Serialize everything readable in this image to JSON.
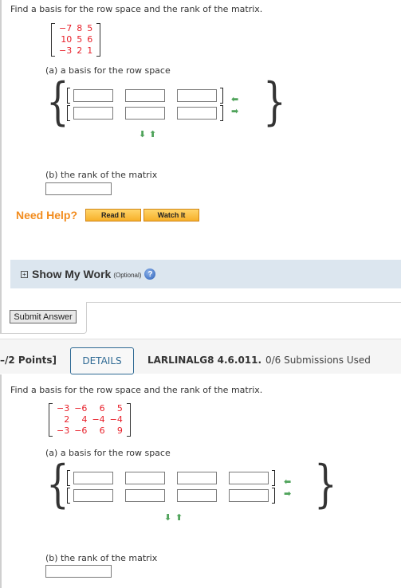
{
  "problem1": {
    "prompt": "Find a basis for the row space and the rank of the matrix.",
    "matrix": [
      [
        "−7",
        "8",
        "5"
      ],
      [
        "10",
        "5",
        "6"
      ],
      [
        "−3",
        "2",
        "1"
      ]
    ],
    "part_a_label": "(a) a basis for the row space",
    "answer_rows": [
      [
        "",
        "",
        ""
      ],
      [
        "",
        "",
        ""
      ]
    ],
    "part_b_label": "(b) the rank of the matrix",
    "rank_value": ""
  },
  "help": {
    "need_help": "Need Help?",
    "read_it": "Read It",
    "watch_it": "Watch It"
  },
  "show_my_work": {
    "expand_icon": "plus-box-icon",
    "title": "Show My Work",
    "optional": "(Optional)",
    "help_icon": "question-icon"
  },
  "submit_label": "Submit Answer",
  "question_header": {
    "points": "–/2 Points]",
    "details_label": "DETAILS",
    "code": "LARLINALG8 4.6.011.",
    "submissions": "0/6 Submissions Used"
  },
  "problem2": {
    "prompt": "Find a basis for the row space and the rank of the matrix.",
    "matrix": [
      [
        "−3",
        "−6",
        "6",
        "5"
      ],
      [
        "2",
        "4",
        "−4",
        "−4"
      ],
      [
        "−3",
        "−6",
        "6",
        "9"
      ]
    ],
    "part_a_label": "(a) a basis for the row space",
    "answer_rows": [
      [
        "",
        "",
        "",
        ""
      ],
      [
        "",
        "",
        "",
        ""
      ]
    ],
    "part_b_label": "(b) the rank of the matrix",
    "rank_value": ""
  },
  "icons": {
    "remove_row": "arrow-left-icon",
    "add_row": "arrow-right-icon",
    "remove_col": "arrow-down-icon",
    "add_col": "arrow-up-icon"
  },
  "colors": {
    "matrix_entries": "#e8202a",
    "need_help": "#f28c1e",
    "help_button": "#f7b02a",
    "show_my_work_bg": "#dce6ef",
    "details_border": "#2f6a94",
    "arrows": "#4fa35a"
  }
}
